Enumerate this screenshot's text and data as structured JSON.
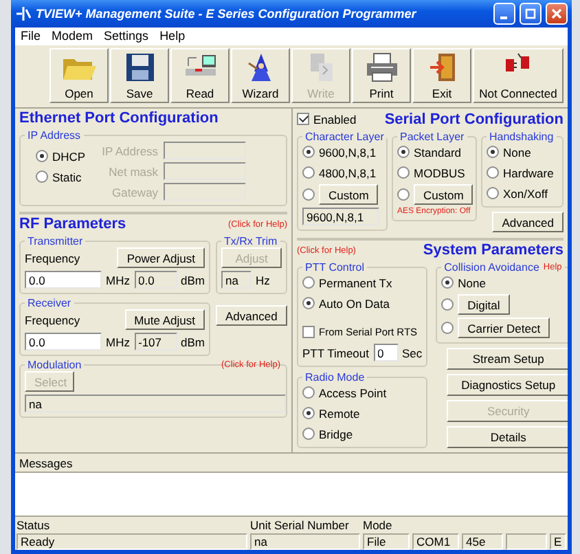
{
  "window": {
    "title": "TVIEW+ Management Suite - E Series Configuration Programmer"
  },
  "menu": [
    "File",
    "Modem",
    "Settings",
    "Help"
  ],
  "toolbar": [
    {
      "label": "Open",
      "disabled": false
    },
    {
      "label": "Save",
      "disabled": false
    },
    {
      "label": "Read",
      "disabled": false
    },
    {
      "label": "Wizard",
      "disabled": false
    },
    {
      "label": "Write",
      "disabled": true
    },
    {
      "label": "Print",
      "disabled": false
    },
    {
      "label": "Exit",
      "disabled": false
    },
    {
      "label": "Not Connected",
      "disabled": false
    }
  ],
  "ethernet": {
    "title": "Ethernet Port Configuration",
    "ip_group": {
      "label": "IP Address",
      "options": [
        {
          "label": "DHCP",
          "selected": true
        },
        {
          "label": "Static",
          "selected": false
        }
      ],
      "fields": [
        {
          "label": "IP Address"
        },
        {
          "label": "Net mask"
        },
        {
          "label": "Gateway"
        }
      ]
    }
  },
  "serial": {
    "enabled": {
      "label": "Enabled",
      "checked": true
    },
    "title": "Serial Port Configuration",
    "character_layer": {
      "label": "Character Layer",
      "options": [
        {
          "label": "9600,N,8,1",
          "selected": true,
          "kind": "radio"
        },
        {
          "label": "4800,N,8,1",
          "selected": false,
          "kind": "radio"
        },
        {
          "label": "Custom",
          "selected": false,
          "kind": "button"
        }
      ],
      "value": "9600,N,8,1"
    },
    "packet_layer": {
      "label": "Packet Layer",
      "options": [
        {
          "label": "Standard",
          "selected": true,
          "kind": "radio"
        },
        {
          "label": "MODBUS",
          "selected": false,
          "kind": "radio"
        },
        {
          "label": "Custom",
          "selected": false,
          "kind": "button"
        }
      ],
      "note": "AES Encryption: Off"
    },
    "handshaking": {
      "label": "Handshaking",
      "options": [
        {
          "label": "None",
          "selected": true,
          "kind": "radio"
        },
        {
          "label": "Hardware",
          "selected": false,
          "kind": "radio"
        },
        {
          "label": "Xon/Xoff",
          "selected": false,
          "kind": "radio"
        }
      ]
    },
    "advanced_button": "Advanced"
  },
  "rf": {
    "title": "RF Parameters",
    "help": "(Click for Help)",
    "transmitter": {
      "label": "Transmitter",
      "frequency_label": "Frequency",
      "button": "Power Adjust",
      "frequency": "0.0",
      "frequency_unit": "MHz",
      "reading": "0.0",
      "reading_unit": "dBm"
    },
    "trim": {
      "label": "Tx/Rx Trim",
      "button": {
        "label": "Adjust",
        "disabled": true
      },
      "value": "na",
      "unit": "Hz"
    },
    "receiver": {
      "label": "Receiver",
      "frequency_label": "Frequency",
      "button": "Mute Adjust",
      "frequency": "0.0",
      "frequency_unit": "MHz",
      "reading": "-107",
      "reading_unit": "dBm"
    },
    "advanced_button": "Advanced",
    "modulation": {
      "label": "Modulation",
      "help": "(Click for Help)",
      "button": {
        "label": "Select",
        "disabled": true
      },
      "value": "na"
    }
  },
  "system": {
    "help": "(Click for Help)",
    "title": "System Parameters",
    "ptt": {
      "label": "PTT Control",
      "options": [
        {
          "label": "Permanent Tx",
          "selected": false,
          "kind": "radio"
        },
        {
          "label": "Auto On Data",
          "selected": true,
          "kind": "radio"
        }
      ],
      "rts": {
        "label": "From Serial Port RTS",
        "checked": false
      },
      "timeout_label": "PTT Timeout",
      "timeout": "0",
      "timeout_unit": "Sec"
    },
    "radio_mode": {
      "label": "Radio Mode",
      "options": [
        {
          "label": "Access Point",
          "selected": false,
          "kind": "radio"
        },
        {
          "label": "Remote",
          "selected": true,
          "kind": "radio"
        },
        {
          "label": "Bridge",
          "selected": false,
          "kind": "radio"
        }
      ]
    },
    "collision": {
      "label": "Collision Avoidance",
      "help": "Help",
      "options": [
        {
          "label": "None",
          "selected": true,
          "kind": "radio"
        },
        {
          "label": "Digital",
          "selected": false,
          "kind": "button"
        },
        {
          "label": "Carrier Detect",
          "selected": false,
          "kind": "button"
        }
      ]
    },
    "buttons": [
      {
        "label": "Stream Setup",
        "disabled": false
      },
      {
        "label": "Diagnostics Setup",
        "disabled": false
      },
      {
        "label": "Security",
        "disabled": true
      },
      {
        "label": "Details",
        "disabled": false
      }
    ]
  },
  "messages": {
    "label": "Messages"
  },
  "status": {
    "labels": [
      "Status",
      "Unit Serial Number",
      "Mode"
    ],
    "cells": [
      "Ready",
      "na",
      "File",
      "COM1",
      "45e",
      "E"
    ]
  }
}
